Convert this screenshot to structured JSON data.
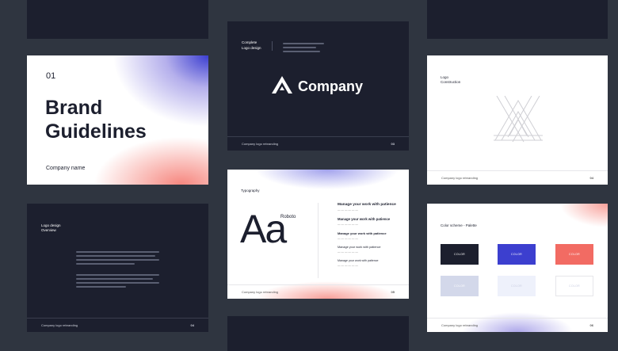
{
  "card_brand": {
    "number": "01",
    "title_line1": "Brand",
    "title_line2": "Guidelines",
    "company": "Company name"
  },
  "card_logo": {
    "header_line1": "Complete",
    "header_line2": "Logo design",
    "company": "Company",
    "footer_left": "Company logo rebranding",
    "footer_right": "03"
  },
  "card_construction": {
    "title_line1": "Logo",
    "title_line2": "Construction",
    "footer_left": "Company logo rebranding",
    "footer_right": "04"
  },
  "card_overview": {
    "title_line1": "Logo design",
    "title_line2": "Overview",
    "footer_left": "Company logo rebranding",
    "footer_right": "04"
  },
  "card_typography": {
    "title": "Typography",
    "font_name": "Roboto",
    "sample": "Aa",
    "rows": [
      {
        "text": "Manage your work with patience"
      },
      {
        "text": "Manage your work with patience"
      },
      {
        "text": "Manage your work with patience"
      },
      {
        "text": "Manage your work with patience"
      },
      {
        "text": "Manage your work with patience"
      }
    ],
    "footer_left": "Company logo rebranding",
    "footer_right": "05"
  },
  "card_colors": {
    "title": "Color scheme - Palette",
    "swatch_label": "COLOR",
    "swatches": [
      "#1c1f2e",
      "#3c3fcf",
      "#f26b63",
      "#d3d8ea",
      "#eef1fb",
      "#ffffff"
    ],
    "footer_left": "Company logo rebranding",
    "footer_right": "06"
  }
}
